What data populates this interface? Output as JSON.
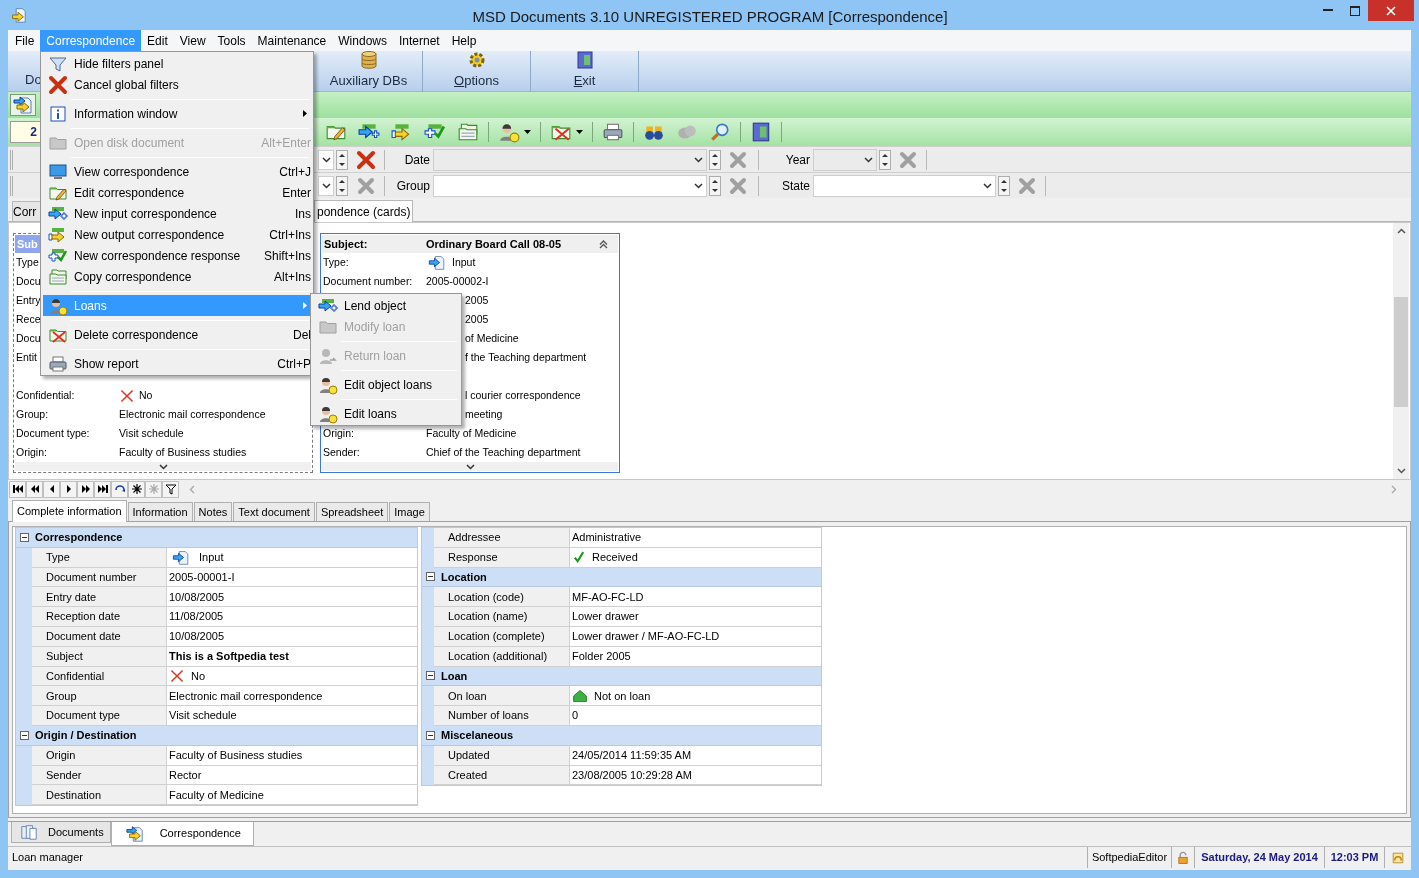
{
  "window": {
    "title": "MSD Documents 3.10 UNREGISTERED PROGRAM [Correspondence]"
  },
  "menu_bar": [
    {
      "label": "File",
      "selected": false
    },
    {
      "label": "Correspondence",
      "selected": true
    },
    {
      "label": "Edit",
      "selected": false
    },
    {
      "label": "View",
      "selected": false
    },
    {
      "label": "Tools",
      "selected": false
    },
    {
      "label": "Maintenance",
      "selected": false
    },
    {
      "label": "Windows",
      "selected": false
    },
    {
      "label": "Internet",
      "selected": false
    },
    {
      "label": "Help",
      "selected": false
    }
  ],
  "main_toolbar": [
    {
      "label": "Do",
      "mnemonic": false
    },
    {
      "label": "Auxiliary DBs",
      "mnemonic": false
    },
    {
      "label": "Options",
      "mnemonic": true
    },
    {
      "label": "Exit",
      "mnemonic": true
    }
  ],
  "record_field": {
    "value": "2"
  },
  "filters": [
    {
      "clear_active": true,
      "fields": [
        {
          "label": "Date",
          "disabled": true
        },
        {
          "label": "Year",
          "disabled": true
        }
      ]
    },
    {
      "clear_active": false,
      "fields": [
        {
          "label": "Group",
          "disabled": false
        },
        {
          "label": "State",
          "disabled": false
        }
      ]
    }
  ],
  "view_tabs": [
    {
      "label": "Corr",
      "selected": false
    },
    {
      "label": "pondence (cards)",
      "selected": true
    }
  ],
  "cards": [
    {
      "selected": true,
      "header": {
        "label": "Sub"
      },
      "rows": [
        {
          "label": "Type"
        },
        {
          "label": "Docu"
        },
        {
          "label": "Entry"
        },
        {
          "label": "Rece"
        },
        {
          "label": "Docu"
        },
        {
          "label": "Entit"
        },
        {
          "kind": "covered"
        },
        {
          "label": "Confidential:",
          "value": "No",
          "kind": "flag"
        },
        {
          "label": "Group:",
          "value": "Electronic mail correspondence"
        },
        {
          "label": "Document type:",
          "value": "Visit schedule"
        },
        {
          "label": "Origin:",
          "value": "Faculty of Business studies"
        }
      ]
    },
    {
      "selected": false,
      "header": {
        "label": "Subject:",
        "value": "Ordinary Board Call 08-05"
      },
      "rows": [
        {
          "label": "Type:",
          "value": "Input",
          "kind": "direction"
        },
        {
          "label": "Document number:",
          "value": "2005-00002-I"
        },
        {
          "kind": "covered",
          "value": "2005"
        },
        {
          "kind": "covered",
          "value": "2005"
        },
        {
          "kind": "covered",
          "value": "of Medicine"
        },
        {
          "kind": "covered",
          "value": "f the Teaching department"
        },
        {
          "kind": "covered"
        },
        {
          "kind": "covered",
          "value": "l courier correspondence"
        },
        {
          "kind": "covered",
          "value": "meeting"
        },
        {
          "label": "Origin:",
          "value": "Faculty of Medicine"
        },
        {
          "label": "Sender:",
          "value": "Chief of the Teaching department"
        }
      ]
    }
  ],
  "correspondence_menu": {
    "groups": [
      [
        {
          "label": "Hide filters panel",
          "disabled": false,
          "selected": false,
          "submenu": false
        },
        {
          "label": "Cancel global filters",
          "disabled": false,
          "selected": false,
          "submenu": false
        }
      ],
      [
        {
          "label": "Information window",
          "disabled": false,
          "selected": false,
          "submenu": true
        }
      ],
      [
        {
          "label": "Open disk document",
          "shortcut": "Alt+Enter",
          "disabled": true,
          "selected": false,
          "submenu": false
        }
      ],
      [
        {
          "label": "View correspondence",
          "shortcut": "Ctrl+J",
          "disabled": false,
          "selected": false,
          "submenu": false
        },
        {
          "label": "Edit correspondence",
          "shortcut": "Enter",
          "disabled": false,
          "selected": false,
          "submenu": false
        },
        {
          "label": "New input correspondence",
          "shortcut": "Ins",
          "disabled": false,
          "selected": false,
          "submenu": false
        },
        {
          "label": "New output correspondence",
          "shortcut": "Ctrl+Ins",
          "disabled": false,
          "selected": false,
          "submenu": false
        },
        {
          "label": "New correspondence response",
          "shortcut": "Shift+Ins",
          "disabled": false,
          "selected": false,
          "submenu": false
        },
        {
          "label": "Copy correspondence",
          "shortcut": "Alt+Ins",
          "disabled": false,
          "selected": false,
          "submenu": false
        }
      ],
      [
        {
          "label": "Loans",
          "disabled": false,
          "selected": true,
          "submenu": true
        }
      ],
      [
        {
          "label": "Delete correspondence",
          "shortcut": "Del",
          "disabled": false,
          "selected": false,
          "submenu": false
        }
      ],
      [
        {
          "label": "Show report",
          "shortcut": "Ctrl+P",
          "disabled": false,
          "selected": false,
          "submenu": false
        }
      ]
    ]
  },
  "loans_submenu": {
    "groups": [
      [
        {
          "label": "Lend object",
          "disabled": false
        },
        {
          "label": "Modify loan",
          "disabled": true
        }
      ],
      [
        {
          "label": "Return loan",
          "disabled": true
        }
      ],
      [
        {
          "label": "Edit object loans",
          "disabled": false
        }
      ],
      [
        {
          "label": "Edit loans",
          "disabled": false
        }
      ]
    ]
  },
  "detail_tabs": [
    {
      "label": "Complete information",
      "selected": true
    },
    {
      "label": "Information",
      "selected": false
    },
    {
      "label": "Notes",
      "selected": false
    },
    {
      "label": "Text document",
      "selected": false
    },
    {
      "label": "Spreadsheet",
      "selected": false
    },
    {
      "label": "Image",
      "selected": false
    }
  ],
  "details": {
    "left": [
      {
        "title": "Correspondence",
        "expanded": true,
        "rows": [
          {
            "label": "Type",
            "value": "Input",
            "kind": "direction"
          },
          {
            "label": "Document number",
            "value": "2005-00001-I"
          },
          {
            "label": "Entry date",
            "value": "10/08/2005"
          },
          {
            "label": "Reception date",
            "value": "11/08/2005"
          },
          {
            "label": "Document date",
            "value": "10/08/2005"
          },
          {
            "label": "Subject",
            "value": "This is a Softpedia test",
            "emphasis": true
          },
          {
            "label": "Confidential",
            "value": "No",
            "kind": "flag"
          },
          {
            "label": "Group",
            "value": "Electronic mail correspondence"
          },
          {
            "label": "Document type",
            "value": "Visit schedule"
          }
        ]
      },
      {
        "title": "Origin / Destination",
        "expanded": true,
        "rows": [
          {
            "label": "Origin",
            "value": "Faculty of Business studies"
          },
          {
            "label": "Sender",
            "value": "Rector"
          },
          {
            "label": "Destination",
            "value": "Faculty of Medicine"
          }
        ]
      }
    ],
    "right": [
      {
        "rows": [
          {
            "label": "Addressee",
            "value": "Administrative"
          },
          {
            "label": "Response",
            "value": "Received",
            "kind": "response"
          }
        ]
      },
      {
        "title": "Location",
        "expanded": true,
        "rows": [
          {
            "label": "Location (code)",
            "value": "MF-AO-FC-LD"
          },
          {
            "label": "Location (name)",
            "value": "Lower drawer"
          },
          {
            "label": "Location (complete)",
            "value": "Lower drawer / MF-AO-FC-LD"
          },
          {
            "label": "Location (additional)",
            "value": "Folder 2005"
          }
        ]
      },
      {
        "title": "Loan",
        "expanded": true,
        "rows": [
          {
            "label": "On loan",
            "value": "Not on loan",
            "kind": "loan"
          },
          {
            "label": "Number of loans",
            "value": "0"
          }
        ]
      },
      {
        "title": "Miscelaneous",
        "expanded": true,
        "rows": [
          {
            "label": "Updated",
            "value": "24/05/2014 11:59:35 AM"
          },
          {
            "label": "Created",
            "value": "23/08/2005 10:29:28 AM"
          }
        ]
      }
    ]
  },
  "bottom_tabs": [
    {
      "label": "Documents",
      "selected": false
    },
    {
      "label": "Correspondence",
      "selected": true
    }
  ],
  "status_bar": {
    "message": "Loan manager",
    "user": "SoftpediaEditor",
    "date": "Saturday, 24 May 2014",
    "time": "12:03 PM"
  }
}
